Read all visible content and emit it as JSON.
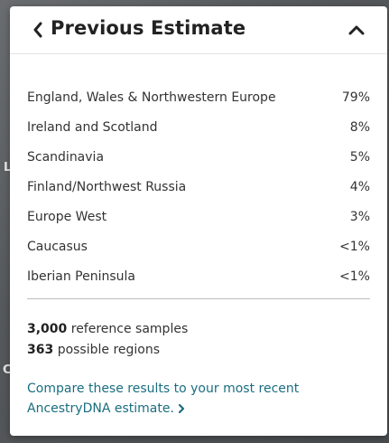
{
  "map": {
    "labels": [
      "L",
      "C"
    ]
  },
  "panel": {
    "title": "Previous Estimate",
    "icons": {
      "back": "chevron-left-icon",
      "collapse": "chevron-up-icon",
      "link": "chevron-right-icon"
    },
    "regions": [
      {
        "name": "England, Wales & Northwestern Europe",
        "percent": "79%"
      },
      {
        "name": "Ireland and Scotland",
        "percent": "8%"
      },
      {
        "name": "Scandinavia",
        "percent": "5%"
      },
      {
        "name": "Finland/Northwest Russia",
        "percent": "4%"
      },
      {
        "name": "Europe West",
        "percent": "3%"
      },
      {
        "name": "Caucasus",
        "percent": "<1%"
      },
      {
        "name": "Iberian Peninsula",
        "percent": "<1%"
      }
    ],
    "stats": {
      "reference_count": "3,000",
      "reference_label": "reference samples",
      "regions_count": "363",
      "regions_label": "possible regions"
    },
    "compare_link": "Compare these results to your most recent AncestryDNA estimate.",
    "colors": {
      "link": "#1a6e80",
      "text": "#333333"
    }
  }
}
